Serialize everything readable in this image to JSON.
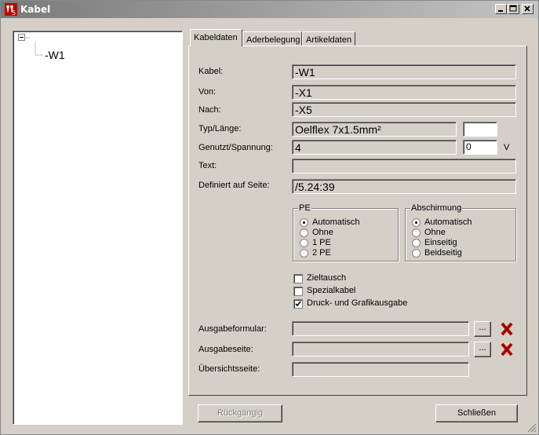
{
  "window": {
    "title": "Kabel"
  },
  "tree": {
    "root_label": "",
    "child_label": "-W1"
  },
  "tabs": [
    {
      "label": "Kabeldaten"
    },
    {
      "label": "Aderbelegung"
    },
    {
      "label": "Artikeldaten"
    }
  ],
  "form": {
    "kabel_label": "Kabel:",
    "kabel_value": "-W1",
    "von_label": "Von:",
    "von_value": "-X1",
    "nach_label": "Nach:",
    "nach_value": "-X5",
    "typ_label": "Typ/Länge:",
    "typ_value": "Oelflex 7x1.5mm²",
    "laenge_value": "",
    "genutzt_label": "Genutzt/Spannung:",
    "genutzt_value": "4",
    "spannung_value": "0",
    "spannung_unit": "V",
    "text_label": "Text:",
    "text_value": "",
    "definiert_label": "Definiert auf Seite:",
    "definiert_value": "/5.24:39"
  },
  "pe_group": {
    "title": "PE",
    "options": [
      "Automatisch",
      "Ohne",
      "1 PE",
      "2 PE"
    ],
    "selected": "Automatisch"
  },
  "abschirmung_group": {
    "title": "Abschirmung",
    "options": [
      "Automatisch",
      "Ohne",
      "Einseitig",
      "Beidseitig"
    ],
    "selected": "Automatisch"
  },
  "checkboxes": [
    {
      "label": "Zieltausch",
      "checked": false
    },
    {
      "label": "Spezialkabel",
      "checked": false
    },
    {
      "label": "Druck- und Grafikausgabe",
      "checked": true
    }
  ],
  "output": {
    "ausgabeformular_label": "Ausgabeformular:",
    "ausgabeformular_value": "",
    "ausgabeseite_label": "Ausgabeseite:",
    "ausgabeseite_value": "",
    "uebersicht_label": "Übersichtsseite:",
    "uebersicht_value": "",
    "browse_label": "..."
  },
  "buttons": {
    "undo": "Rückgängig",
    "close": "Schließen"
  },
  "colors": {
    "delete_icon": "#c00000",
    "title_gradient_start": "#7a7a7a"
  }
}
